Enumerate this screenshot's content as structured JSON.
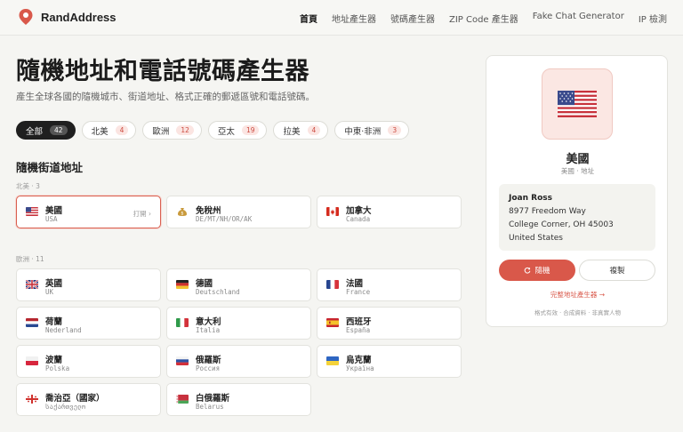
{
  "header": {
    "brand": "RandAddress",
    "nav": [
      "首頁",
      "地址產生器",
      "號碼產生器",
      "ZIP Code 產生器",
      "Fake Chat Generator",
      "IP 檢測"
    ]
  },
  "hero": {
    "title": "隨機地址和電話號碼產生器",
    "subtitle": "產生全球各國的隨機城市、街道地址、格式正確的郵遞區號和電話號碼。"
  },
  "filters": [
    {
      "label": "全部",
      "count": "42"
    },
    {
      "label": "北美",
      "count": "4"
    },
    {
      "label": "歐洲",
      "count": "12"
    },
    {
      "label": "亞太",
      "count": "19"
    },
    {
      "label": "拉美",
      "count": "4"
    },
    {
      "label": "中東·非洲",
      "count": "3"
    }
  ],
  "section_title": "隨機街道地址",
  "groups": {
    "north_america": {
      "label": "北美 · 3"
    },
    "europe": {
      "label": "歐洲 · 11"
    }
  },
  "cards": [
    {
      "name": "美國",
      "code": "USA",
      "action": "打開 ›"
    },
    {
      "name": "免稅州",
      "code": "DE/MT/NH/OR/AK"
    },
    {
      "name": "加拿大",
      "code": "Canada"
    },
    {
      "name": "英國",
      "code": "UK"
    },
    {
      "name": "德國",
      "code": "Deutschland"
    },
    {
      "name": "法國",
      "code": "France"
    },
    {
      "name": "荷蘭",
      "code": "Nederland"
    },
    {
      "name": "意大利",
      "code": "Italia"
    },
    {
      "name": "西班牙",
      "code": "España"
    },
    {
      "name": "波蘭",
      "code": "Polska"
    },
    {
      "name": "俄羅斯",
      "code": "Россия"
    },
    {
      "name": "烏克蘭",
      "code": "Україна"
    },
    {
      "name": "喬治亞（國家）",
      "code": "საქართველო"
    },
    {
      "name": "白俄羅斯",
      "code": "Belarus"
    }
  ],
  "panel": {
    "country": "美國",
    "sub": "美國 · 地址",
    "address": {
      "name": "Joan Ross",
      "line1": "8977 Freedom Way",
      "line2": "College Corner, OH 45003",
      "line3": "United States"
    },
    "generate_label": "隨機",
    "copy_label": "複製",
    "link": "完整地址產生器 →",
    "footer": "格式有效 · 合成資料 · 非真實人物"
  },
  "colors": {
    "accent": "#d9584a",
    "bg": "#f5f5f2"
  }
}
